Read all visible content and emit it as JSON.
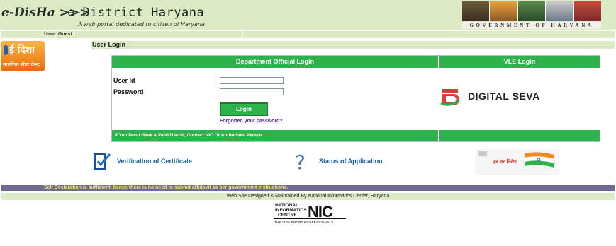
{
  "header": {
    "logo_text": "e-DisHa >>>",
    "site_title": "e-District Haryana",
    "tagline": "A web portal dedicated to citizen of Haryana",
    "gov_caption": "GOVERNMENT OF HARYANA"
  },
  "nav": {
    "user_label": "User: Guest ::"
  },
  "side_logo": {
    "text_line1": "ई दिशा",
    "text_line2": "नागरिक सेवा केन्द्र"
  },
  "page_heading": "User Login",
  "login": {
    "dept_heading": "Department Official Login",
    "vle_heading": "VLE Login",
    "userid_label": "User Id",
    "password_label": "Password",
    "userid_value": "",
    "password_value": "",
    "login_button": "Login",
    "forgot_link": "Forgotten your password?",
    "footer_note": "If You Don't Have A Valid Userid, Contact NIC Or Authorised Person"
  },
  "vle": {
    "brand_text": "DIGITAL SEVA"
  },
  "links": {
    "verification": "Verification of Certificate",
    "status": "Status of Application"
  },
  "banner": {
    "hindi_text": "हर घर तिरंगा"
  },
  "declaration": "Self Declaration is sufficient, hence there is no need to submit affidavit as per government instructions.",
  "credit": "Web Site Designed & Maintained By National Informatics Center, Haryana",
  "nic": {
    "line1": "NATIONAL",
    "line2": "INFORMATICS",
    "line3": "CENTRE",
    "mark": "NIC",
    "tagline": "THE IT SUPPORT PROFESSIONALS"
  },
  "colors": {
    "header_bg": "#dcebc4",
    "green": "#2db34a",
    "decl_bg": "#6e6a90",
    "decl_text": "#f3e37a",
    "link": "#1b5f9f"
  }
}
